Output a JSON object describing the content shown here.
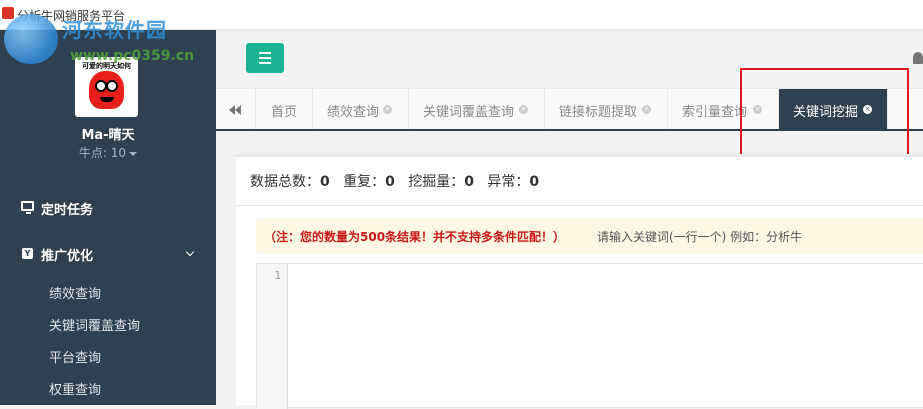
{
  "window": {
    "title": "分析牛网销服务平台"
  },
  "watermark": {
    "site_name": "河东软件园",
    "url": "www.pc0359.cn"
  },
  "sidebar": {
    "avatar_caption": "可爱的明天如何",
    "username": "Ma-晴天",
    "points": "牛点: 10",
    "nav_top": {
      "label": "定时任务",
      "icon": "monitor-icon"
    },
    "group": {
      "label": "推广优化",
      "icon": "y-badge-icon",
      "expanded": true
    },
    "sub_items": [
      {
        "label": "绩效查询"
      },
      {
        "label": "关键词覆盖查询"
      },
      {
        "label": "平台查询"
      },
      {
        "label": "权重查询"
      }
    ]
  },
  "header": {
    "menu_icon": "hamburger-icon",
    "bell_icon": "bell-icon",
    "accent": "#1ab394"
  },
  "tabs": [
    {
      "label": "首页",
      "closable": false,
      "active": false
    },
    {
      "label": "绩效查询",
      "closable": true,
      "active": false
    },
    {
      "label": "关键词覆盖查询",
      "closable": true,
      "active": false
    },
    {
      "label": "链接标题提取",
      "closable": true,
      "active": false
    },
    {
      "label": "索引量查询",
      "closable": true,
      "active": false
    },
    {
      "label": "关键词挖掘",
      "closable": true,
      "active": true
    }
  ],
  "stats": {
    "total_label": "数据总数：",
    "total_value": "0",
    "dup_label": "重复：",
    "dup_value": "0",
    "mined_label": "挖掘量：",
    "mined_value": "0",
    "error_label": "异常：",
    "error_value": "0"
  },
  "notice": {
    "warning": "（注：您的数量为500条结果！并不支持多条件匹配！）",
    "hint": "请输入关键词(一行一个)  例如：分析牛"
  },
  "editor": {
    "line_number": "1",
    "content": ""
  },
  "colors": {
    "sidebar_bg": "#2f4050",
    "highlight_box": "#e2131c",
    "warning_text": "#c81919"
  }
}
